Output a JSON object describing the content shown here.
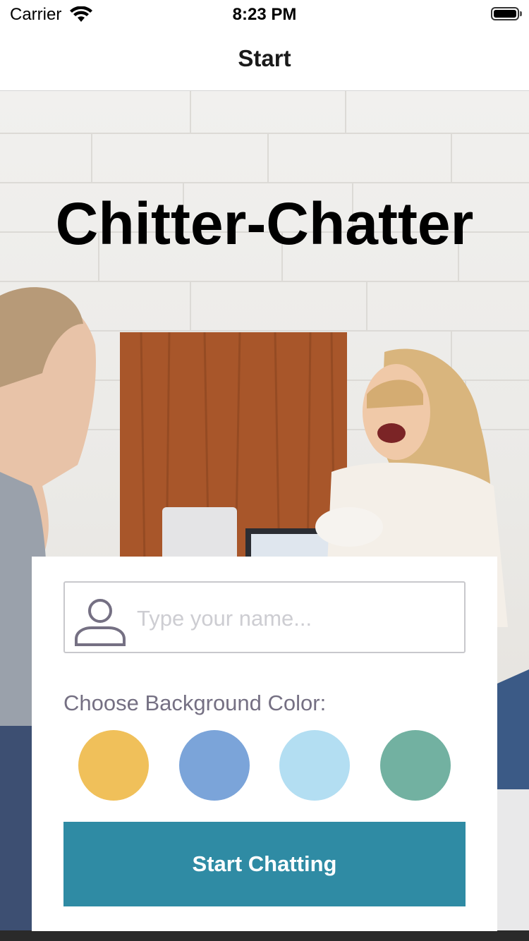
{
  "status_bar": {
    "carrier": "Carrier",
    "time": "8:23 PM"
  },
  "nav": {
    "title": "Start"
  },
  "hero": {
    "app_title": "Chitter-Chatter"
  },
  "form": {
    "name_placeholder": "Type your name...",
    "name_value": "",
    "color_label": "Choose Background Color:",
    "colors": [
      {
        "name": "yellow",
        "hex": "#F0C05A"
      },
      {
        "name": "blue",
        "hex": "#7BA4D9"
      },
      {
        "name": "light-blue",
        "hex": "#B3DEF2"
      },
      {
        "name": "green",
        "hex": "#72B1A1"
      }
    ],
    "button_label": "Start Chatting",
    "button_color": "#2F8BA4"
  }
}
